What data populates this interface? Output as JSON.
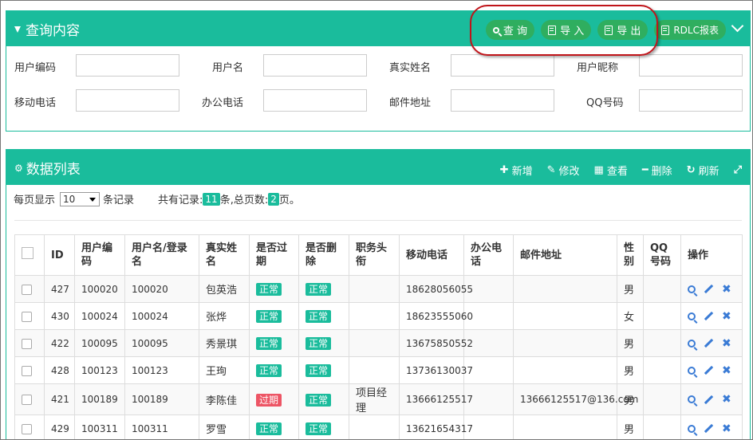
{
  "query_panel": {
    "title": "查询内容",
    "buttons": [
      {
        "label": "查 询",
        "icon": "search-icon"
      },
      {
        "label": "导 入",
        "icon": "file-icon"
      },
      {
        "label": "导 出",
        "icon": "file-icon"
      },
      {
        "label": "RDLC报表",
        "icon": "file-icon"
      }
    ],
    "fields": [
      {
        "label": "用户编码",
        "value": ""
      },
      {
        "label": "用户名",
        "value": ""
      },
      {
        "label": "真实姓名",
        "value": ""
      },
      {
        "label": "用户昵称",
        "value": ""
      },
      {
        "label": "移动电话",
        "value": ""
      },
      {
        "label": "办公电话",
        "value": ""
      },
      {
        "label": "邮件地址",
        "value": ""
      },
      {
        "label": "QQ号码",
        "value": ""
      }
    ]
  },
  "list_panel": {
    "title": "数据列表",
    "tools": [
      {
        "label": "新增",
        "icon": "plus-icon"
      },
      {
        "label": "修改",
        "icon": "pencil-icon"
      },
      {
        "label": "查看",
        "icon": "table-icon"
      },
      {
        "label": "删除",
        "icon": "minus-icon"
      },
      {
        "label": "刷新",
        "icon": "refresh-icon"
      }
    ],
    "paging": {
      "per_page_label": "每页显示",
      "per_page_value": "10",
      "records_label": "条记录",
      "total_label": "共有记录:",
      "total_count": "11",
      "total_unit": "条,总页数:",
      "pages": "2",
      "pages_unit": "页。"
    },
    "columns": [
      "ID",
      "用户编码",
      "用户名/登录名",
      "真实姓名",
      "是否过期",
      "是否删除",
      "职务头衔",
      "移动电话",
      "办公电话",
      "邮件地址",
      "性别",
      "QQ号码",
      "操作"
    ],
    "rows": [
      {
        "id": "427",
        "code": "100020",
        "username": "100020",
        "realname": "包英浩",
        "expired": "正常",
        "expired_ok": true,
        "deleted": "正常",
        "title": "",
        "mobile": "18628056055",
        "office": "",
        "email": "",
        "gender": "男",
        "qq": ""
      },
      {
        "id": "430",
        "code": "100024",
        "username": "100024",
        "realname": "张烨",
        "expired": "正常",
        "expired_ok": true,
        "deleted": "正常",
        "title": "",
        "mobile": "18623555060",
        "office": "",
        "email": "",
        "gender": "女",
        "qq": ""
      },
      {
        "id": "422",
        "code": "100095",
        "username": "100095",
        "realname": "秀景琪",
        "expired": "正常",
        "expired_ok": true,
        "deleted": "正常",
        "title": "",
        "mobile": "13675850552",
        "office": "",
        "email": "",
        "gender": "男",
        "qq": ""
      },
      {
        "id": "428",
        "code": "100123",
        "username": "100123",
        "realname": "王珣",
        "expired": "正常",
        "expired_ok": true,
        "deleted": "正常",
        "title": "",
        "mobile": "13736130037",
        "office": "",
        "email": "",
        "gender": "男",
        "qq": ""
      },
      {
        "id": "421",
        "code": "100189",
        "username": "100189",
        "realname": "李陈佳",
        "expired": "过期",
        "expired_ok": false,
        "deleted": "正常",
        "title": "项目经理",
        "mobile": "13666125517",
        "office": "",
        "email": "13666125517@136.com",
        "gender": "男",
        "qq": ""
      },
      {
        "id": "429",
        "code": "100311",
        "username": "100311",
        "realname": "罗雪",
        "expired": "正常",
        "expired_ok": true,
        "deleted": "正常",
        "title": "",
        "mobile": "13621654317",
        "office": "",
        "email": "",
        "gender": "男",
        "qq": ""
      }
    ]
  },
  "colors": {
    "primary": "#1abc9c",
    "button_green": "#2fae5f",
    "danger": "#ed5565",
    "action_blue": "#3a7bd5",
    "highlight": "#c0141a"
  }
}
